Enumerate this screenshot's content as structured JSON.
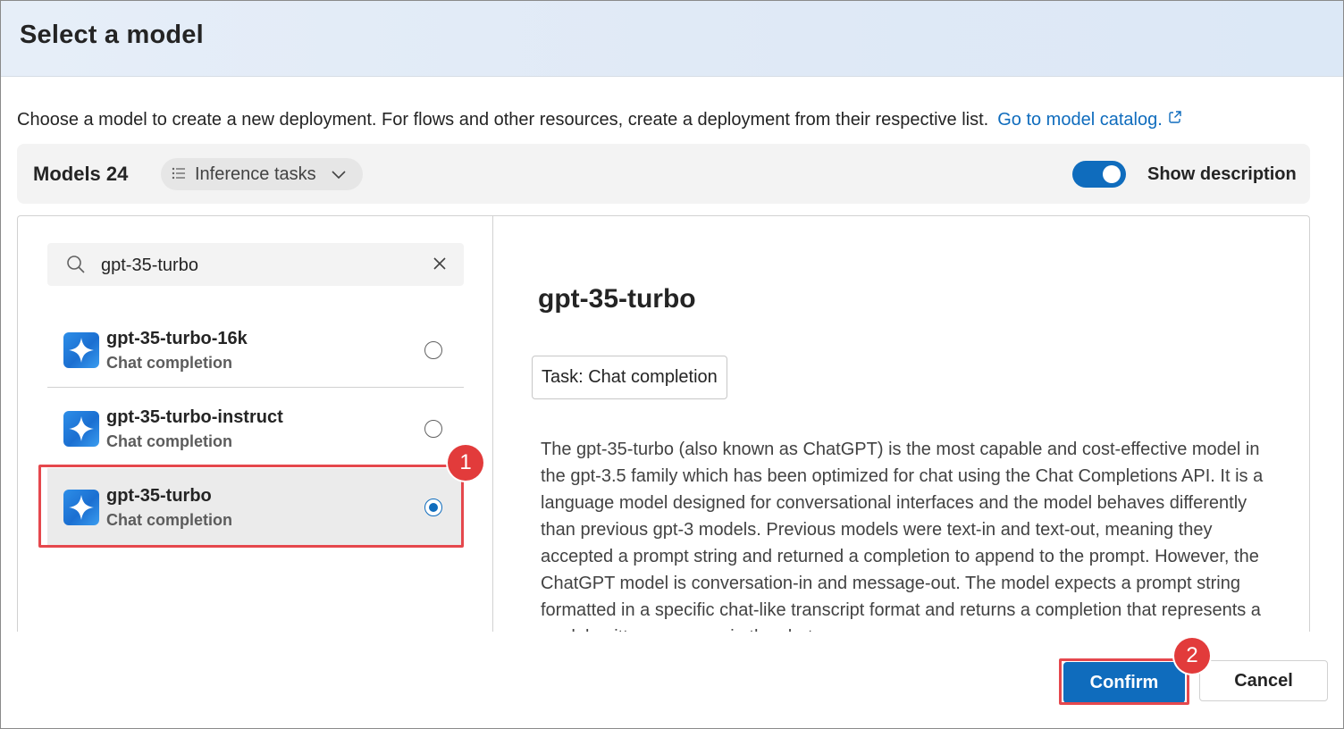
{
  "dialog": {
    "title": "Select a model",
    "intro_text": "Choose a model to create a new deployment. For flows and other resources, create a deployment from their respective list.",
    "catalog_link": "Go to model catalog."
  },
  "toolbar": {
    "models_label": "Models 24",
    "filter_label": "Inference tasks",
    "toggle_label": "Show description",
    "toggle_on": true
  },
  "search": {
    "value": "gpt-35-turbo"
  },
  "models": [
    {
      "name": "gpt-35-turbo-16k",
      "task": "Chat completion",
      "selected": false
    },
    {
      "name": "gpt-35-turbo-instruct",
      "task": "Chat completion",
      "selected": false
    },
    {
      "name": "gpt-35-turbo",
      "task": "Chat completion",
      "selected": true
    }
  ],
  "detail": {
    "title": "gpt-35-turbo",
    "task_chip": "Task: Chat completion",
    "description": "The gpt-35-turbo (also known as ChatGPT) is the most capable and cost-effective model in the gpt-3.5 family which has been optimized for chat using the Chat Completions API. It is a language model designed for conversational interfaces and the model behaves differently than previous gpt-3 models. Previous models were text-in and text-out, meaning they accepted a prompt string and returned a completion to append to the prompt. However, the ChatGPT model is conversation-in and message-out. The model expects a prompt string formatted in a specific chat-like transcript format and returns a completion that represents a model-written message in the chat."
  },
  "annotations": {
    "badge_1": "1",
    "badge_2": "2"
  },
  "footer": {
    "confirm_label": "Confirm",
    "cancel_label": "Cancel"
  },
  "colors": {
    "accent": "#0f6cbd",
    "highlight": "#e5484d",
    "badge": "#e23b3b",
    "header_bg": "#e2ebf7"
  },
  "icons": {
    "filter": "list-filter-icon",
    "chevron": "chevron-down-icon",
    "search": "search-icon",
    "clear": "close-icon",
    "external": "external-link-icon",
    "model": "sparkle-icon"
  }
}
